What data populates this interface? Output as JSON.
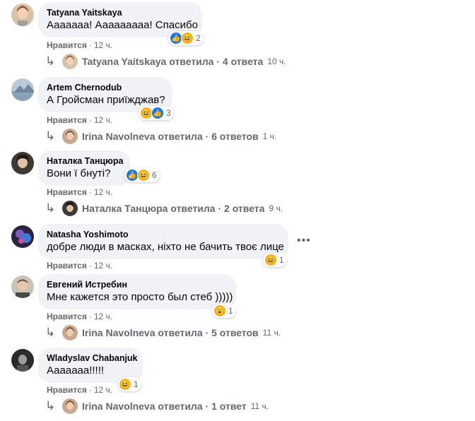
{
  "comments": [
    {
      "author": "Tatyana Yaitskaya",
      "text": "Ааааааа! Ааааааааа! Спасибо",
      "like_label": "Нравится",
      "time": "12 ч.",
      "reactions": {
        "icons": [
          "like-icon",
          "haha-icon"
        ],
        "count": "2"
      },
      "reply": {
        "name": "Tatyana Yaitskaya",
        "verb": "ответила",
        "count": "4 ответа",
        "time": "10 ч."
      }
    },
    {
      "author": "Artem Chernodub",
      "text": "А Гройсман приїжджав?",
      "like_label": "Нравится",
      "time": "12 ч.",
      "reactions": {
        "icons": [
          "haha-icon",
          "like-icon"
        ],
        "count": "3"
      },
      "reply": {
        "name": "Irina Navolneva",
        "verb": "ответила",
        "count": "6 ответов",
        "time": "1 ч."
      }
    },
    {
      "author": "Наталка Танцюра",
      "text": "Вони ї бнуті?",
      "like_label": "Нравится",
      "time": "12 ч.",
      "reactions": {
        "icons": [
          "like-icon",
          "haha-icon"
        ],
        "count": "6"
      },
      "reply": {
        "name": "Наталка Танцюра",
        "verb": "ответила",
        "count": "2 ответа",
        "time": "9 ч."
      }
    },
    {
      "author": "Natasha Yoshimoto",
      "text": "добре люди в масках, ніхто не бачить твоє лице",
      "like_label": "Нравится",
      "time": "12 ч.",
      "reactions": {
        "icons": [
          "haha-icon"
        ],
        "count": "1"
      },
      "more": "•••"
    },
    {
      "author": "Евгений Истребин",
      "text": "Мне кажется это просто был стеб )))))",
      "like_label": "Нравится",
      "time": "12 ч.",
      "reactions": {
        "icons": [
          "wow-icon"
        ],
        "count": "1"
      },
      "reply": {
        "name": "Irina Navolneva",
        "verb": "ответила",
        "count": "5 ответов",
        "time": "11 ч."
      }
    },
    {
      "author": "Wladyslav Chabanjuk",
      "text": "Ааааааа!!!!!",
      "like_label": "Нравится",
      "time": "12 ч.",
      "reactions": {
        "icons": [
          "haha-icon"
        ],
        "count": "1"
      },
      "reply": {
        "name": "Irina Navolneva",
        "verb": "ответила",
        "count": "1 ответ",
        "time": "11 ч."
      }
    }
  ],
  "separator": "·",
  "reply_arrow": "↳",
  "colors": {
    "bubble": "#f0f2f5",
    "secondary_text": "#65676b",
    "like_blue": "#1877f2",
    "emoji_yellow": "#f7b125"
  }
}
